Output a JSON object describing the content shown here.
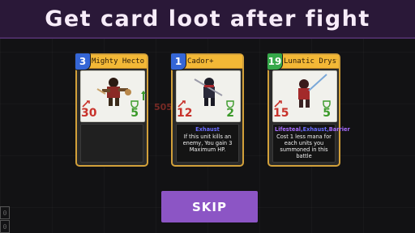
{
  "banner": {
    "title": "Get card loot after fight"
  },
  "background": {
    "ghost_text": "505",
    "edge_left_top": "0",
    "edge_left_bottom": "0"
  },
  "cards": [
    {
      "name": "Mighty Hector",
      "mana": "3",
      "mana_color": "#3566d6",
      "attack": "30",
      "health": "5",
      "description_keywords": "",
      "description_text": "",
      "art_icon": "pirate-warrior-icon"
    },
    {
      "name": "Cador+",
      "mana": "1",
      "mana_color": "#3566d6",
      "attack": "12",
      "health": "2",
      "description_keywords": "Exhaust",
      "description_text": "If this unit kills an enemy, You gain 3 Maximum HP.",
      "art_icon": "ninja-icon"
    },
    {
      "name": "Lunatic Dryst",
      "mana": "19",
      "mana_color": "#36a84a",
      "attack": "15",
      "health": "5",
      "description_keywords_parts": [
        "Lifesteal",
        ",",
        "Exhaust",
        ",",
        "Barrier"
      ],
      "description_text": "Cost 1 less mana for each units you summoned in this battle",
      "art_icon": "swordsman-icon"
    }
  ],
  "actions": {
    "skip_label": "SKIP"
  },
  "colors": {
    "banner_bg": "#2a1838",
    "card_border": "#d2a03a",
    "skip_bg": "#8c55c5",
    "attack": "#c8322b",
    "health": "#3b9a2a"
  }
}
